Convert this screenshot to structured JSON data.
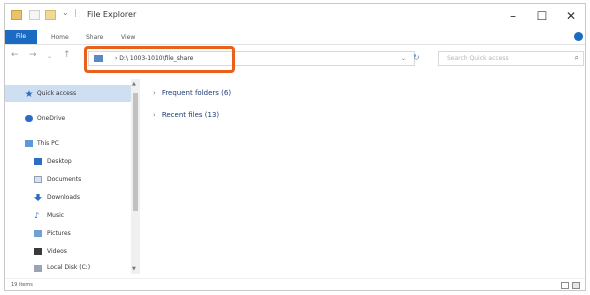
{
  "window": {
    "title": "File Explorer",
    "controls": {
      "minimize": "–",
      "maximize": "☐",
      "close": "✕"
    }
  },
  "ribbon": {
    "tabs": [
      "File",
      "Home",
      "Share",
      "View"
    ]
  },
  "toolbar": {
    "back": "←",
    "forward": "→",
    "up": "↑"
  },
  "address": {
    "value": "› D:\\ 1003-1010\\file_share",
    "dropdown": "⌄"
  },
  "search": {
    "placeholder": "Search Quick access"
  },
  "nav": {
    "items": [
      {
        "label": "Quick access",
        "icon": "star-icon",
        "selected": true
      },
      {
        "label": "OneDrive",
        "icon": "cloud-icon"
      },
      {
        "label": "This PC",
        "icon": "computer-icon"
      },
      {
        "label": "Desktop",
        "icon": "desktop-folder-icon"
      },
      {
        "label": "Documents",
        "icon": "documents-folder-icon"
      },
      {
        "label": "Downloads",
        "icon": "downloads-folder-icon"
      },
      {
        "label": "Music",
        "icon": "music-folder-icon"
      },
      {
        "label": "Pictures",
        "icon": "pictures-folder-icon"
      },
      {
        "label": "Videos",
        "icon": "videos-folder-icon"
      },
      {
        "label": "Local Disk (C:)",
        "icon": "disk-icon"
      }
    ]
  },
  "content": {
    "groups": [
      {
        "label": "Frequent folders (6)"
      },
      {
        "label": "Recent files (13)"
      }
    ]
  },
  "status": {
    "text": "19 items"
  },
  "colors": {
    "accent": "#1b6bc4",
    "highlight": "#e8601c",
    "selection": "#cfdff2",
    "group_text": "#1e3a78"
  }
}
